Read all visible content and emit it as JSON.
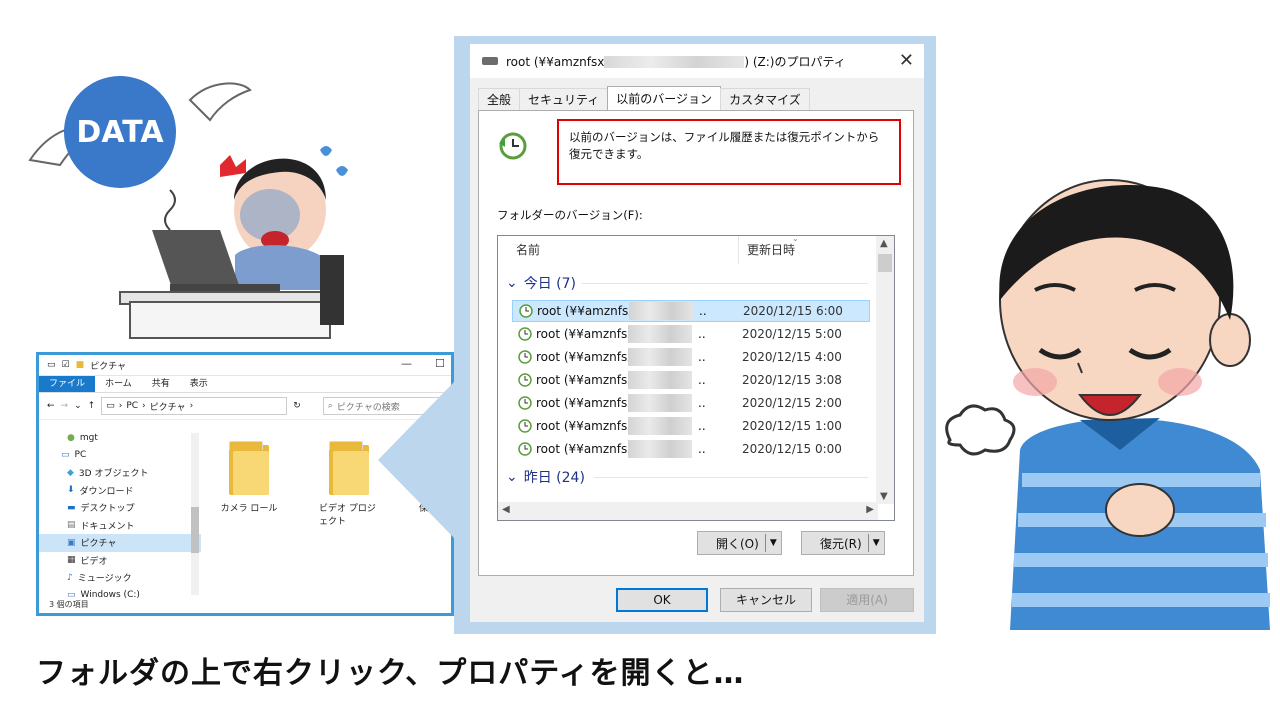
{
  "caption": "フォルダの上で右クリック、プロパティを開くと…",
  "illustration_left": {
    "badge": "DATA"
  },
  "explorer": {
    "title": "ピクチャ",
    "ribbon": [
      "ファイル",
      "ホーム",
      "共有",
      "表示"
    ],
    "breadcrumb": [
      "PC",
      "ピクチャ"
    ],
    "search_placeholder": "ピクチャの検索",
    "sidebar": [
      {
        "label": "mgt",
        "icon": "user-icon"
      },
      {
        "label": "PC",
        "icon": "pc-icon"
      },
      {
        "label": "3D オブジェクト",
        "icon": "3d-objects-icon"
      },
      {
        "label": "ダウンロード",
        "icon": "download-icon"
      },
      {
        "label": "デスクトップ",
        "icon": "desktop-icon"
      },
      {
        "label": "ドキュメント",
        "icon": "document-icon"
      },
      {
        "label": "ピクチャ",
        "icon": "pictures-icon",
        "selected": true
      },
      {
        "label": "ビデオ",
        "icon": "video-icon"
      },
      {
        "label": "ミュージック",
        "icon": "music-icon"
      },
      {
        "label": "Windows (C:)",
        "icon": "drive-icon"
      }
    ],
    "folders": [
      "カメラ ロール",
      "ビデオ プロジェクト",
      "保存済"
    ],
    "status": "3 個の項目"
  },
  "dialog": {
    "title_prefix": "root (¥¥amznfsx",
    "title_suffix": ") (Z:)のプロパティ",
    "tabs": [
      "全般",
      "セキュリティ",
      "以前のバージョン",
      "カスタマイズ"
    ],
    "active_tab": "以前のバージョン",
    "info_text": "以前のバージョンは、ファイル履歴または復元ポイントから復元できます。",
    "folder_versions_label": "フォルダーのバージョン(F):",
    "columns": [
      "名前",
      "更新日時"
    ],
    "groups": [
      {
        "label": "今日 (7)",
        "rows": [
          {
            "name": "root (¥¥amznfsx",
            "suffix": "..",
            "date": "2020/12/15 6:00",
            "selected": true
          },
          {
            "name": "root (¥¥amznfsx",
            "suffix": "..",
            "date": "2020/12/15 5:00"
          },
          {
            "name": "root (¥¥amznfsx",
            "suffix": "..",
            "date": "2020/12/15 4:00"
          },
          {
            "name": "root (¥¥amznfsx",
            "suffix": "..",
            "date": "2020/12/15 3:08"
          },
          {
            "name": "root (¥¥amznfsx",
            "suffix": "..",
            "date": "2020/12/15 2:00"
          },
          {
            "name": "root (¥¥amznfsx",
            "suffix": "..",
            "date": "2020/12/15 1:00"
          },
          {
            "name": "root (¥¥amznfsx",
            "suffix": "..",
            "date": "2020/12/15 0:00"
          }
        ]
      },
      {
        "label": "昨日 (24)"
      }
    ],
    "open_button": "開く(O)",
    "restore_button": "復元(R)",
    "ok": "OK",
    "cancel": "キャンセル",
    "apply": "適用(A)"
  },
  "colors": {
    "highlight_border": "#e00000",
    "accent": "#0078d7",
    "selection": "#cce8ff"
  }
}
